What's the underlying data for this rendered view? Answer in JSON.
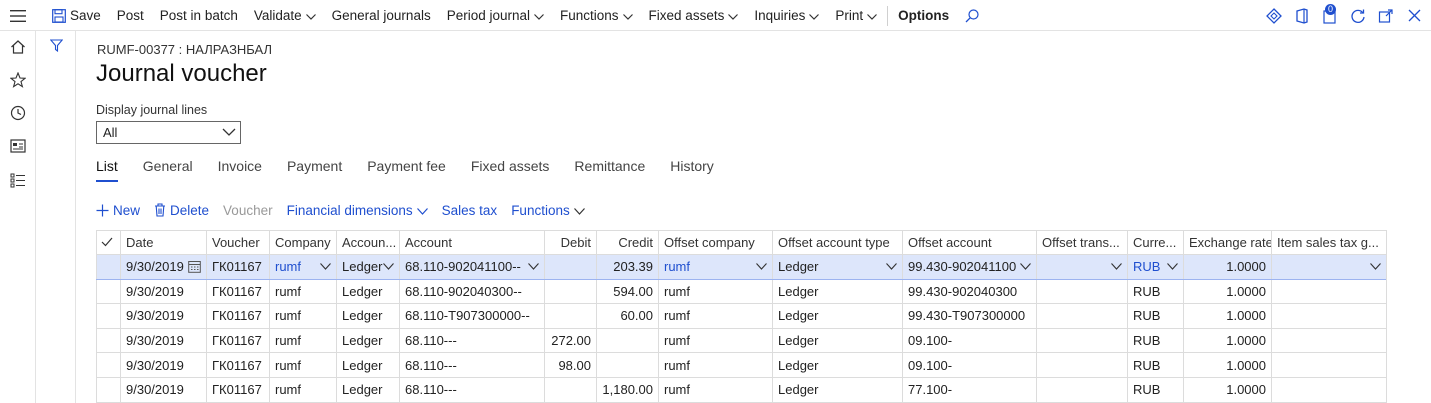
{
  "topbar": {
    "actions": [
      "Save",
      "Post",
      "Post in batch",
      "Validate",
      "General journals",
      "Period journal",
      "Functions",
      "Fixed assets",
      "Inquiries",
      "Print",
      "Options"
    ],
    "badge_count": "0"
  },
  "header": {
    "breadcrumb": "RUMF-00377 : НАЛРАЗНБАЛ",
    "title": "Journal voucher"
  },
  "display_lines": {
    "label": "Display journal lines",
    "value": "All"
  },
  "tabs": [
    "List",
    "General",
    "Invoice",
    "Payment",
    "Payment fee",
    "Fixed assets",
    "Remittance",
    "History"
  ],
  "grid_toolbar": {
    "new": "New",
    "delete": "Delete",
    "voucher": "Voucher",
    "financial_dimensions": "Financial dimensions",
    "sales_tax": "Sales tax",
    "functions": "Functions"
  },
  "grid": {
    "columns": [
      "Date",
      "Voucher",
      "Company",
      "Accoun...",
      "Account",
      "Debit",
      "Credit",
      "Offset company",
      "Offset account type",
      "Offset account",
      "Offset trans...",
      "Curre...",
      "Exchange rate",
      "Item sales tax g..."
    ],
    "rows": [
      {
        "date": "9/30/2019",
        "voucher": "ГК01167",
        "company": "rumf",
        "acctype": "Ledger",
        "account": "68.110-902041100--",
        "debit": "",
        "credit": "203.39",
        "offcompany": "rumf",
        "offtype": "Ledger",
        "offaccount": "99.430-902041100",
        "offtrans": "",
        "currency": "RUB",
        "rate": "1.0000",
        "taxgroup": ""
      },
      {
        "date": "9/30/2019",
        "voucher": "ГК01167",
        "company": "rumf",
        "acctype": "Ledger",
        "account": "68.110-902040300--",
        "debit": "",
        "credit": "594.00",
        "offcompany": "rumf",
        "offtype": "Ledger",
        "offaccount": "99.430-902040300",
        "offtrans": "",
        "currency": "RUB",
        "rate": "1.0000",
        "taxgroup": ""
      },
      {
        "date": "9/30/2019",
        "voucher": "ГК01167",
        "company": "rumf",
        "acctype": "Ledger",
        "account": "68.110-T907300000--",
        "debit": "",
        "credit": "60.00",
        "offcompany": "rumf",
        "offtype": "Ledger",
        "offaccount": "99.430-T907300000",
        "offtrans": "",
        "currency": "RUB",
        "rate": "1.0000",
        "taxgroup": ""
      },
      {
        "date": "9/30/2019",
        "voucher": "ГК01167",
        "company": "rumf",
        "acctype": "Ledger",
        "account": "68.110---",
        "debit": "272.00",
        "credit": "",
        "offcompany": "rumf",
        "offtype": "Ledger",
        "offaccount": "09.100-",
        "offtrans": "",
        "currency": "RUB",
        "rate": "1.0000",
        "taxgroup": ""
      },
      {
        "date": "9/30/2019",
        "voucher": "ГК01167",
        "company": "rumf",
        "acctype": "Ledger",
        "account": "68.110---",
        "debit": "98.00",
        "credit": "",
        "offcompany": "rumf",
        "offtype": "Ledger",
        "offaccount": "09.100-",
        "offtrans": "",
        "currency": "RUB",
        "rate": "1.0000",
        "taxgroup": ""
      },
      {
        "date": "9/30/2019",
        "voucher": "ГК01167",
        "company": "rumf",
        "acctype": "Ledger",
        "account": "68.110---",
        "debit": "",
        "credit": "1,180.00",
        "offcompany": "rumf",
        "offtype": "Ledger",
        "offaccount": "77.100-",
        "offtrans": "",
        "currency": "RUB",
        "rate": "1.0000",
        "taxgroup": ""
      }
    ]
  },
  "colors": {
    "accent": "#1f4fcf",
    "selected_row": "#dde6fb"
  }
}
